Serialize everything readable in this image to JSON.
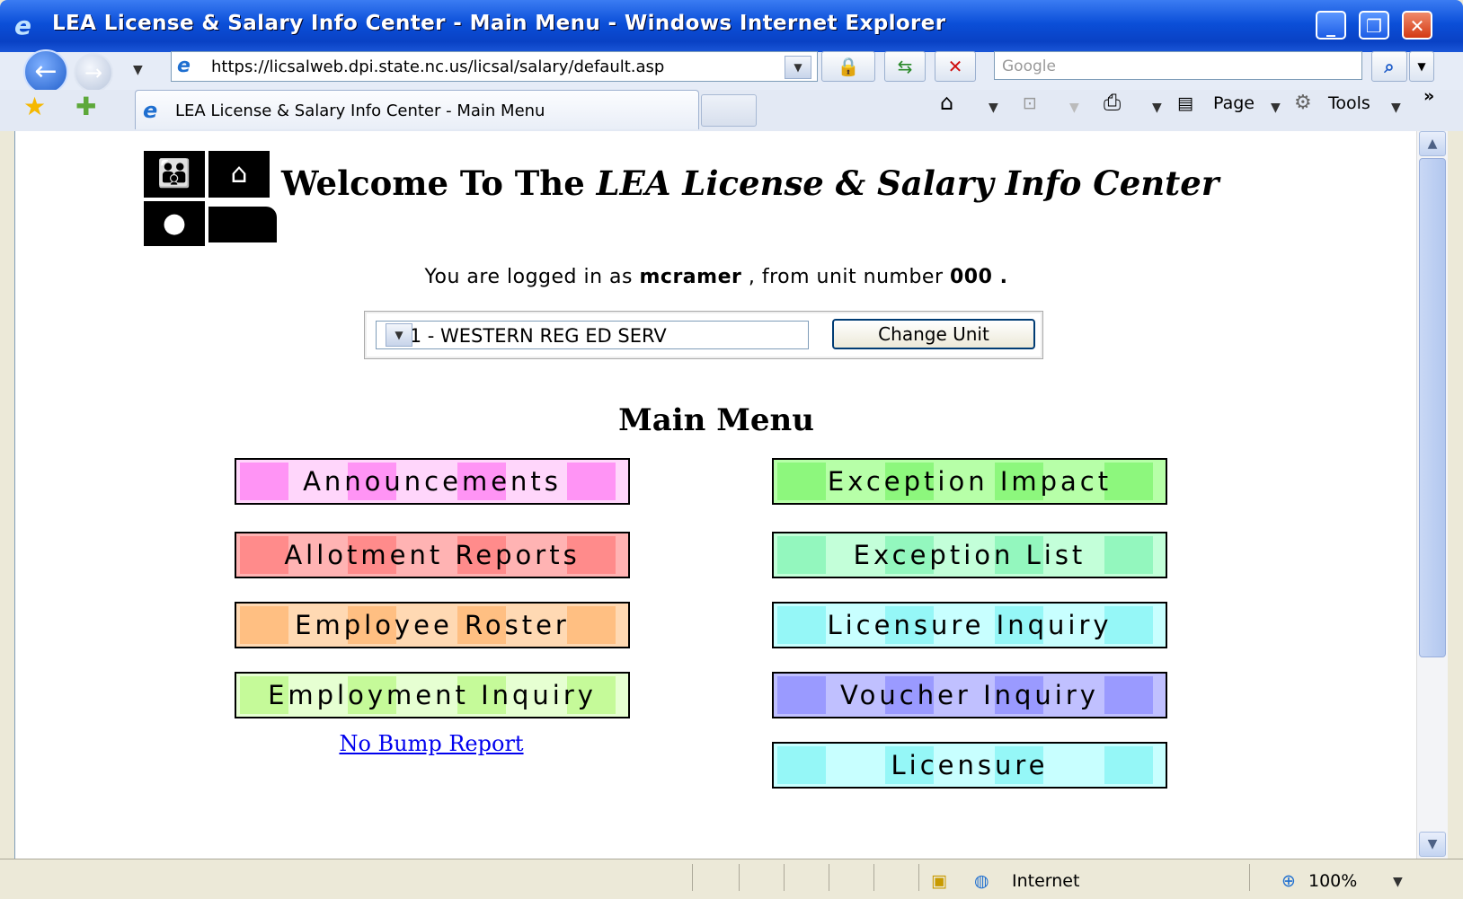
{
  "window": {
    "title": "LEA License & Salary Info Center - Main Menu - Windows Internet Explorer",
    "minimize": "_",
    "maximize": "❐",
    "close": "✕"
  },
  "nav": {
    "url": "https://licsalweb.dpi.state.nc.us/licsal/salary/default.asp",
    "search_placeholder": "Google"
  },
  "tabs": {
    "active_tab": "LEA License & Salary Info Center - Main Menu"
  },
  "commandbar": {
    "page_label": "Page",
    "tools_label": "Tools"
  },
  "page": {
    "welcome_prefix": "Welcome To The ",
    "welcome_italic": "LEA License & Salary Info Center",
    "logged_in_prefix": "You are logged in as ",
    "username": "mcramer",
    "logged_in_middle": " , from unit number ",
    "unit_number": "000",
    "logged_in_suffix": " .",
    "unit_selected": "001 - WESTERN REG ED SERV",
    "change_unit_label": "Change Unit",
    "main_menu_title": "Main Menu",
    "menu_left": [
      {
        "label": "Announcements",
        "color": "#ffd6fb",
        "accent": "#ff5ef0"
      },
      {
        "label": "Allotment Reports",
        "color": "#ffb3b3",
        "accent": "#ff6a6a"
      },
      {
        "label": "Employee Roster",
        "color": "#ffd9b3",
        "accent": "#ffaa5a"
      },
      {
        "label": "Employment Inquiry",
        "color": "#e6ffd2",
        "accent": "#a9f56a"
      }
    ],
    "menu_right": [
      {
        "label": "Exception Impact",
        "color": "#b7ffa8",
        "accent": "#6cf05a"
      },
      {
        "label": "Exception List",
        "color": "#c3ffd9",
        "accent": "#6cf0a8"
      },
      {
        "label": "Licensure Inquiry",
        "color": "#c8ffff",
        "accent": "#6cf0f0"
      },
      {
        "label": "Voucher Inquiry",
        "color": "#c0c0ff",
        "accent": "#7a7aff"
      },
      {
        "label": "Licensure",
        "color": "#c8ffff",
        "accent": "#6cf0f0"
      }
    ],
    "no_bump_link": "No Bump Report"
  },
  "status": {
    "zone": "Internet",
    "zoom": "100%"
  }
}
